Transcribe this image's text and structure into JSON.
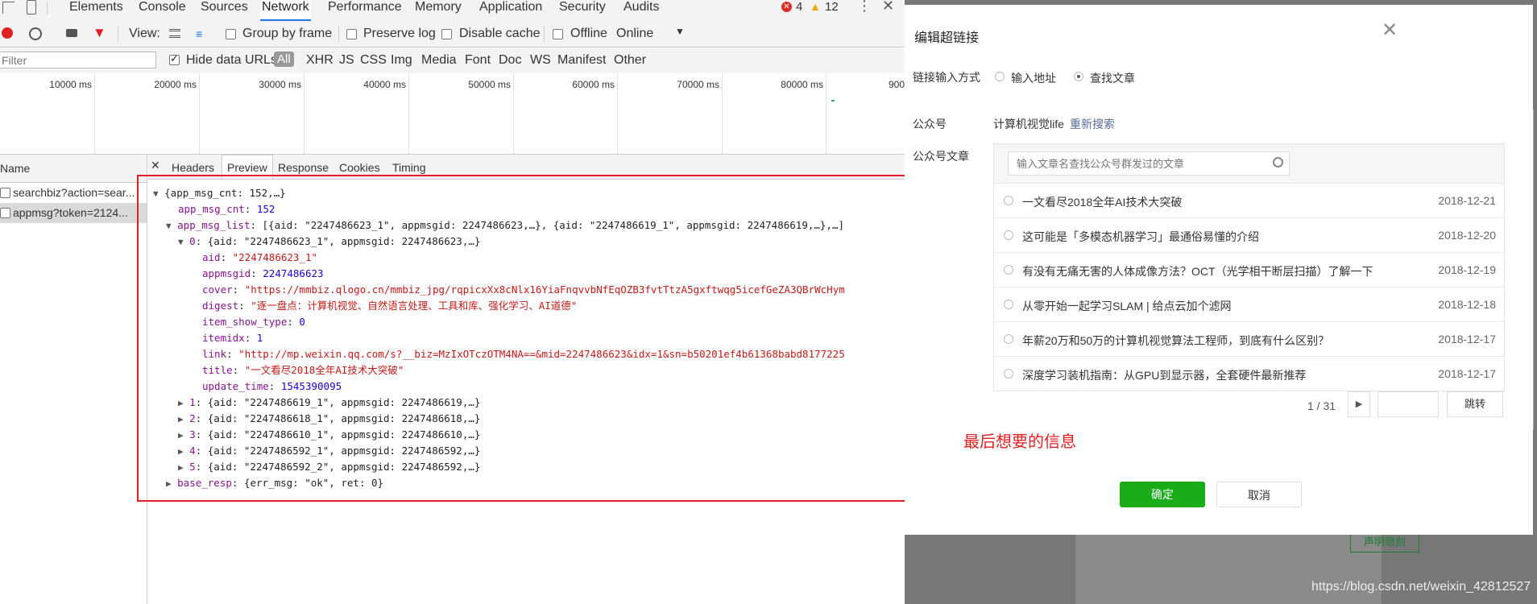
{
  "devtools": {
    "tabs": [
      "Elements",
      "Console",
      "Sources",
      "Network",
      "Performance",
      "Memory",
      "Application",
      "Security",
      "Audits"
    ],
    "active_tab": "Network",
    "error_count": "4",
    "warning_count": "12",
    "toolbar": {
      "view_label": "View:",
      "group_by_frame": "Group by frame",
      "preserve_log": "Preserve log",
      "disable_cache": "Disable cache",
      "offline": "Offline",
      "throttle": "Online"
    },
    "filter": {
      "placeholder": "Filter",
      "hide_data_urls": "Hide data URLs",
      "types": [
        "All",
        "XHR",
        "JS",
        "CSS",
        "Img",
        "Media",
        "Font",
        "Doc",
        "WS",
        "Manifest",
        "Other"
      ]
    },
    "timeline_ticks": [
      "10000 ms",
      "20000 ms",
      "30000 ms",
      "40000 ms",
      "50000 ms",
      "60000 ms",
      "70000 ms",
      "80000 ms",
      "900"
    ],
    "requests": {
      "header": "Name",
      "rows": [
        "searchbiz?action=sear...",
        "appmsg?token=2124..."
      ]
    },
    "preview_tabs": [
      "Headers",
      "Preview",
      "Response",
      "Cookies",
      "Timing"
    ],
    "json_lines": [
      {
        "t": "{app_msg_cnt: 152,…}"
      },
      {
        "k": "app_msg_cnt",
        "v": "152",
        "vt": "n"
      },
      {
        "k": "app_msg_list",
        "v": "[{aid: \"2247486623_1\", appmsgid: 2247486623,…}, {aid: \"2247486619_1\", appmsgid: 2247486619,…},…]",
        "vt": "p"
      },
      {
        "k": "0",
        "v": "{aid: \"2247486623_1\", appmsgid: 2247486623,…}",
        "vt": "p"
      },
      {
        "k": "aid",
        "v": "\"2247486623_1\"",
        "vt": "s"
      },
      {
        "k": "appmsgid",
        "v": "2247486623",
        "vt": "n"
      },
      {
        "k": "cover",
        "v": "\"https://mmbiz.qlogo.cn/mmbiz_jpg/rqpicxXx8cNlx16YiaFnqvvbNfEqOZB3fvtTtzA5gxftwqg5icefGeZA3QBrWcHym",
        "vt": "s"
      },
      {
        "k": "digest",
        "v": "\"逐一盘点：计算机视觉、自然语言处理、工具和库、强化学习、AI道德\"",
        "vt": "s"
      },
      {
        "k": "item_show_type",
        "v": "0",
        "vt": "n"
      },
      {
        "k": "itemidx",
        "v": "1",
        "vt": "n"
      },
      {
        "k": "link",
        "v": "\"http://mp.weixin.qq.com/s?__biz=MzIxOTczOTM4NA==&mid=2247486623&idx=1&sn=b50201ef4b61368babd8177225",
        "vt": "s"
      },
      {
        "k": "title",
        "v": "\"一文看尽2018全年AI技术大突破\"",
        "vt": "s"
      },
      {
        "k": "update_time",
        "v": "1545390095",
        "vt": "n"
      },
      {
        "k": "1",
        "v": "{aid: \"2247486619_1\", appmsgid: 2247486619,…}",
        "vt": "p"
      },
      {
        "k": "2",
        "v": "{aid: \"2247486618_1\", appmsgid: 2247486618,…}",
        "vt": "p"
      },
      {
        "k": "3",
        "v": "{aid: \"2247486610_1\", appmsgid: 2247486610,…}",
        "vt": "p"
      },
      {
        "k": "4",
        "v": "{aid: \"2247486592_1\", appmsgid: 2247486592,…}",
        "vt": "p"
      },
      {
        "k": "5",
        "v": "{aid: \"2247486592_2\", appmsgid: 2247486592,…}",
        "vt": "p"
      },
      {
        "k": "base_resp",
        "v": "{err_msg: \"ok\", ret: 0}",
        "vt": "p"
      }
    ]
  },
  "modal": {
    "title": "编辑超链接",
    "input_mode_label": "链接输入方式",
    "mode_address": "输入地址",
    "mode_search": "查找文章",
    "account_label": "公众号",
    "account_name": "计算机视觉life",
    "research_link": "重新搜索",
    "articles_label": "公众号文章",
    "search_placeholder": "输入文章名查找公众号群发过的文章",
    "articles": [
      {
        "title": "一文看尽2018全年AI技术大突破",
        "date": "2018-12-21"
      },
      {
        "title": "这可能是「多模态机器学习」最通俗易懂的介绍",
        "date": "2018-12-20"
      },
      {
        "title": "有没有无痛无害的人体成像方法？OCT（光学相干断层扫描）了解一下",
        "date": "2018-12-19"
      },
      {
        "title": "从零开始一起学习SLAM | 给点云加个滤网",
        "date": "2018-12-18"
      },
      {
        "title": "年薪20万和50万的计算机视觉算法工程师，到底有什么区别？",
        "date": "2018-12-17"
      },
      {
        "title": "深度学习装机指南：从GPU到显示器，全套硬件最新推荐",
        "date": "2018-12-17"
      }
    ],
    "pager": "1 / 31",
    "jump_button": "跳转",
    "annotation": "最后想要的信息",
    "confirm": "确定",
    "cancel": "取消"
  },
  "background": {
    "original_button": "声明原创",
    "watermark": "https://blog.csdn.net/weixin_42812527"
  },
  "colors": {
    "accent": "#1a73e8",
    "confirm_green": "#1aad19",
    "annotation_red": "#e02020"
  }
}
